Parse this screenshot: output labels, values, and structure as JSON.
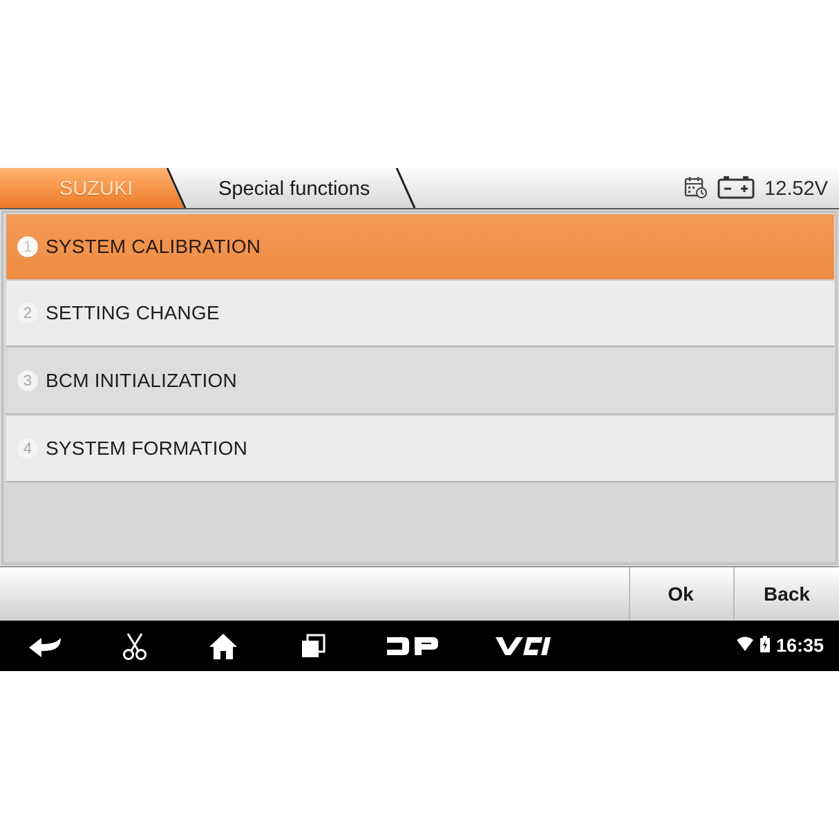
{
  "header": {
    "brand": "SUZUKI",
    "page_title": "Special functions",
    "voltage": "12.52V",
    "icons": [
      "calendar-clock-icon",
      "battery-icon"
    ]
  },
  "menu": {
    "items": [
      {
        "number": "1",
        "label": "SYSTEM CALIBRATION",
        "selected": true
      },
      {
        "number": "2",
        "label": "SETTING CHANGE",
        "selected": false
      },
      {
        "number": "3",
        "label": "BCM INITIALIZATION",
        "selected": false
      },
      {
        "number": "4",
        "label": "SYSTEM FORMATION",
        "selected": false
      }
    ]
  },
  "footer": {
    "ok_label": "Ok",
    "back_label": "Back"
  },
  "navbar": {
    "icons": [
      "back-arrow-icon",
      "scissors-icon",
      "home-icon",
      "recent-apps-icon",
      "dp-icon",
      "vci-icon"
    ],
    "dp_label": "DP",
    "vci_label": "VCI",
    "time": "16:35"
  },
  "colors": {
    "accent": "#ee8d45",
    "selected_row": "#f39a57",
    "navbar": "#000000"
  }
}
